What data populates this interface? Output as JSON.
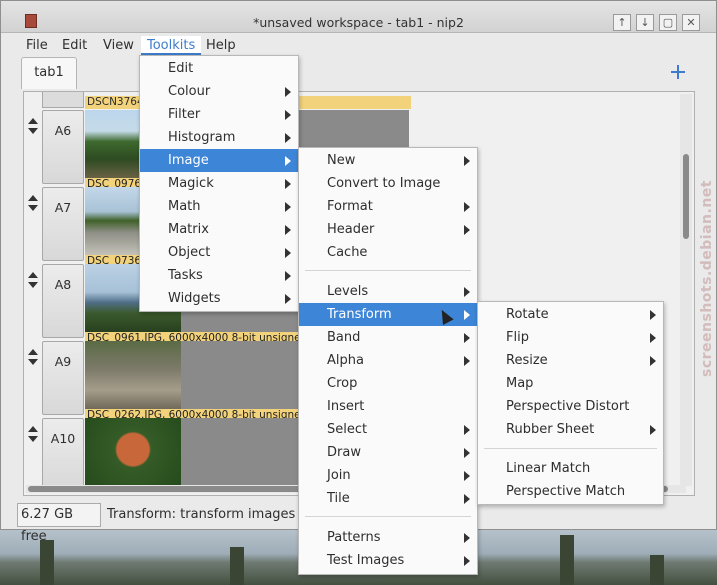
{
  "window": {
    "title": "*unsaved workspace - tab1 - nip2",
    "controls": [
      "↑",
      "↓",
      "▢",
      "✕"
    ]
  },
  "menubar": {
    "items": [
      "File",
      "Edit",
      "View",
      "Toolkits",
      "Help"
    ]
  },
  "tab": {
    "label": "tab1"
  },
  "rows": [
    {
      "id": "top",
      "caption": "DSCN3764. integer, 3 bands, sRGB"
    },
    {
      "id": "A6",
      "label": "A6",
      "caption": "DSC_0976."
    },
    {
      "id": "A7",
      "label": "A7",
      "caption": "DSC_0736."
    },
    {
      "id": "A8",
      "label": "A8",
      "caption": "DSC_0961.JPG, 6000x4000 8-bit unsigned in"
    },
    {
      "id": "A9",
      "label": "A9",
      "caption": "DSC_0262.JPG, 6000x4000 8-bit unsigned in"
    },
    {
      "id": "A10",
      "label": "A10",
      "caption": ""
    }
  ],
  "status": {
    "free": "6.27 GB free",
    "message": "Transform: transform images"
  },
  "toolkits_menu": [
    {
      "label": "Edit",
      "submenu": false
    },
    {
      "label": "Colour",
      "submenu": true
    },
    {
      "label": "Filter",
      "submenu": true
    },
    {
      "label": "Histogram",
      "submenu": true
    },
    {
      "label": "Image",
      "submenu": true,
      "highlighted": true
    },
    {
      "label": "Magick",
      "submenu": true
    },
    {
      "label": "Math",
      "submenu": true
    },
    {
      "label": "Matrix",
      "submenu": true
    },
    {
      "label": "Object",
      "submenu": true
    },
    {
      "label": "Tasks",
      "submenu": true
    },
    {
      "label": "Widgets",
      "submenu": true
    }
  ],
  "image_menu": [
    {
      "label": "New",
      "submenu": true
    },
    {
      "label": "Convert to Image",
      "submenu": false
    },
    {
      "label": "Format",
      "submenu": true
    },
    {
      "label": "Header",
      "submenu": true
    },
    {
      "label": "Cache",
      "submenu": false
    },
    {
      "label": "Levels",
      "submenu": true
    },
    {
      "label": "Transform",
      "submenu": true,
      "highlighted": true
    },
    {
      "label": "Band",
      "submenu": true
    },
    {
      "label": "Alpha",
      "submenu": true
    },
    {
      "label": "Crop",
      "submenu": false
    },
    {
      "label": "Insert",
      "submenu": false
    },
    {
      "label": "Select",
      "submenu": true
    },
    {
      "label": "Draw",
      "submenu": true
    },
    {
      "label": "Join",
      "submenu": true
    },
    {
      "label": "Tile",
      "submenu": true
    },
    {
      "label": "Patterns",
      "submenu": true
    },
    {
      "label": "Test Images",
      "submenu": true
    }
  ],
  "transform_menu": [
    {
      "label": "Rotate",
      "submenu": true
    },
    {
      "label": "Flip",
      "submenu": true
    },
    {
      "label": "Resize",
      "submenu": true
    },
    {
      "label": "Map",
      "submenu": false
    },
    {
      "label": "Perspective Distort",
      "submenu": false
    },
    {
      "label": "Rubber Sheet",
      "submenu": true
    },
    {
      "label": "Linear Match",
      "submenu": false
    },
    {
      "label": "Perspective Match",
      "submenu": false
    }
  ],
  "watermark": "screenshots.debian.net",
  "colors": {
    "accent": "#3d85d6",
    "caption": "#f2d27a"
  }
}
